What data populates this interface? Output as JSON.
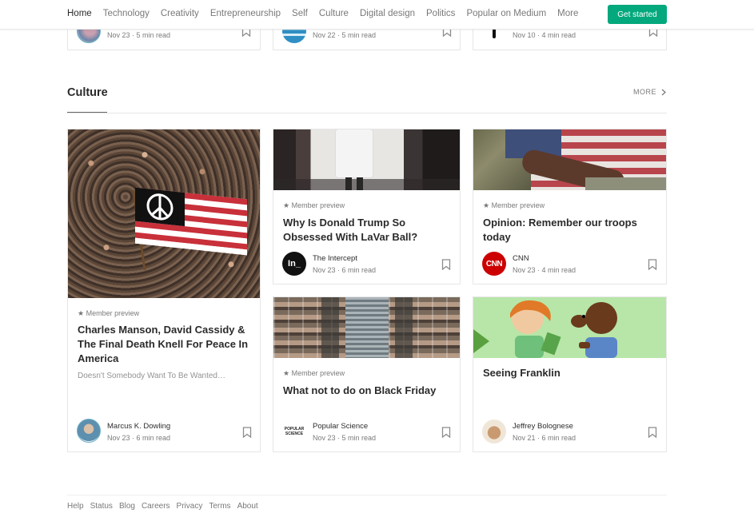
{
  "nav": {
    "items": [
      "Home",
      "Technology",
      "Creativity",
      "Entrepreneurship",
      "Self",
      "Culture",
      "Digital design",
      "Politics",
      "Popular on Medium",
      "More"
    ],
    "cta": "Get started",
    "accent": "#03a87c"
  },
  "top_cards": [
    {
      "meta": "Nov 23 · 5 min read"
    },
    {
      "meta": "Nov 22 · 5 min read"
    },
    {
      "meta": "Nov 10 · 4 min read"
    }
  ],
  "section": {
    "title": "Culture",
    "more": "MORE"
  },
  "cards": [
    {
      "label": "Member preview",
      "title": "Charles Manson, David Cassidy & The Final Death Knell For Peace In America",
      "subtitle": "Doesn't Somebody Want To Be Wanted…",
      "author": "Marcus K. Dowling",
      "meta": "Nov 23 · 6 min read"
    },
    {
      "label": "Member preview",
      "title": "Why Is Donald Trump So Obsessed With LaVar Ball?",
      "author": "The Intercept",
      "logo_text": "In_",
      "meta": "Nov 23 · 6 min read"
    },
    {
      "label": "Member preview",
      "title": "Opinion: Remember our troops today",
      "author": "CNN",
      "logo_text": "CNN",
      "meta": "Nov 23 · 4 min read"
    },
    {
      "label": "Member preview",
      "title": "What not to do on Black Friday",
      "author": "Popular Science",
      "logo_text": "POPULAR SCIENCE",
      "meta": "Nov 23 · 5 min read"
    },
    {
      "title": "Seeing Franklin",
      "author": "Jeffrey Bolognese",
      "meta": "Nov 21 · 6 min read"
    }
  ],
  "footer": [
    "Help",
    "Status",
    "Blog",
    "Careers",
    "Privacy",
    "Terms",
    "About"
  ]
}
